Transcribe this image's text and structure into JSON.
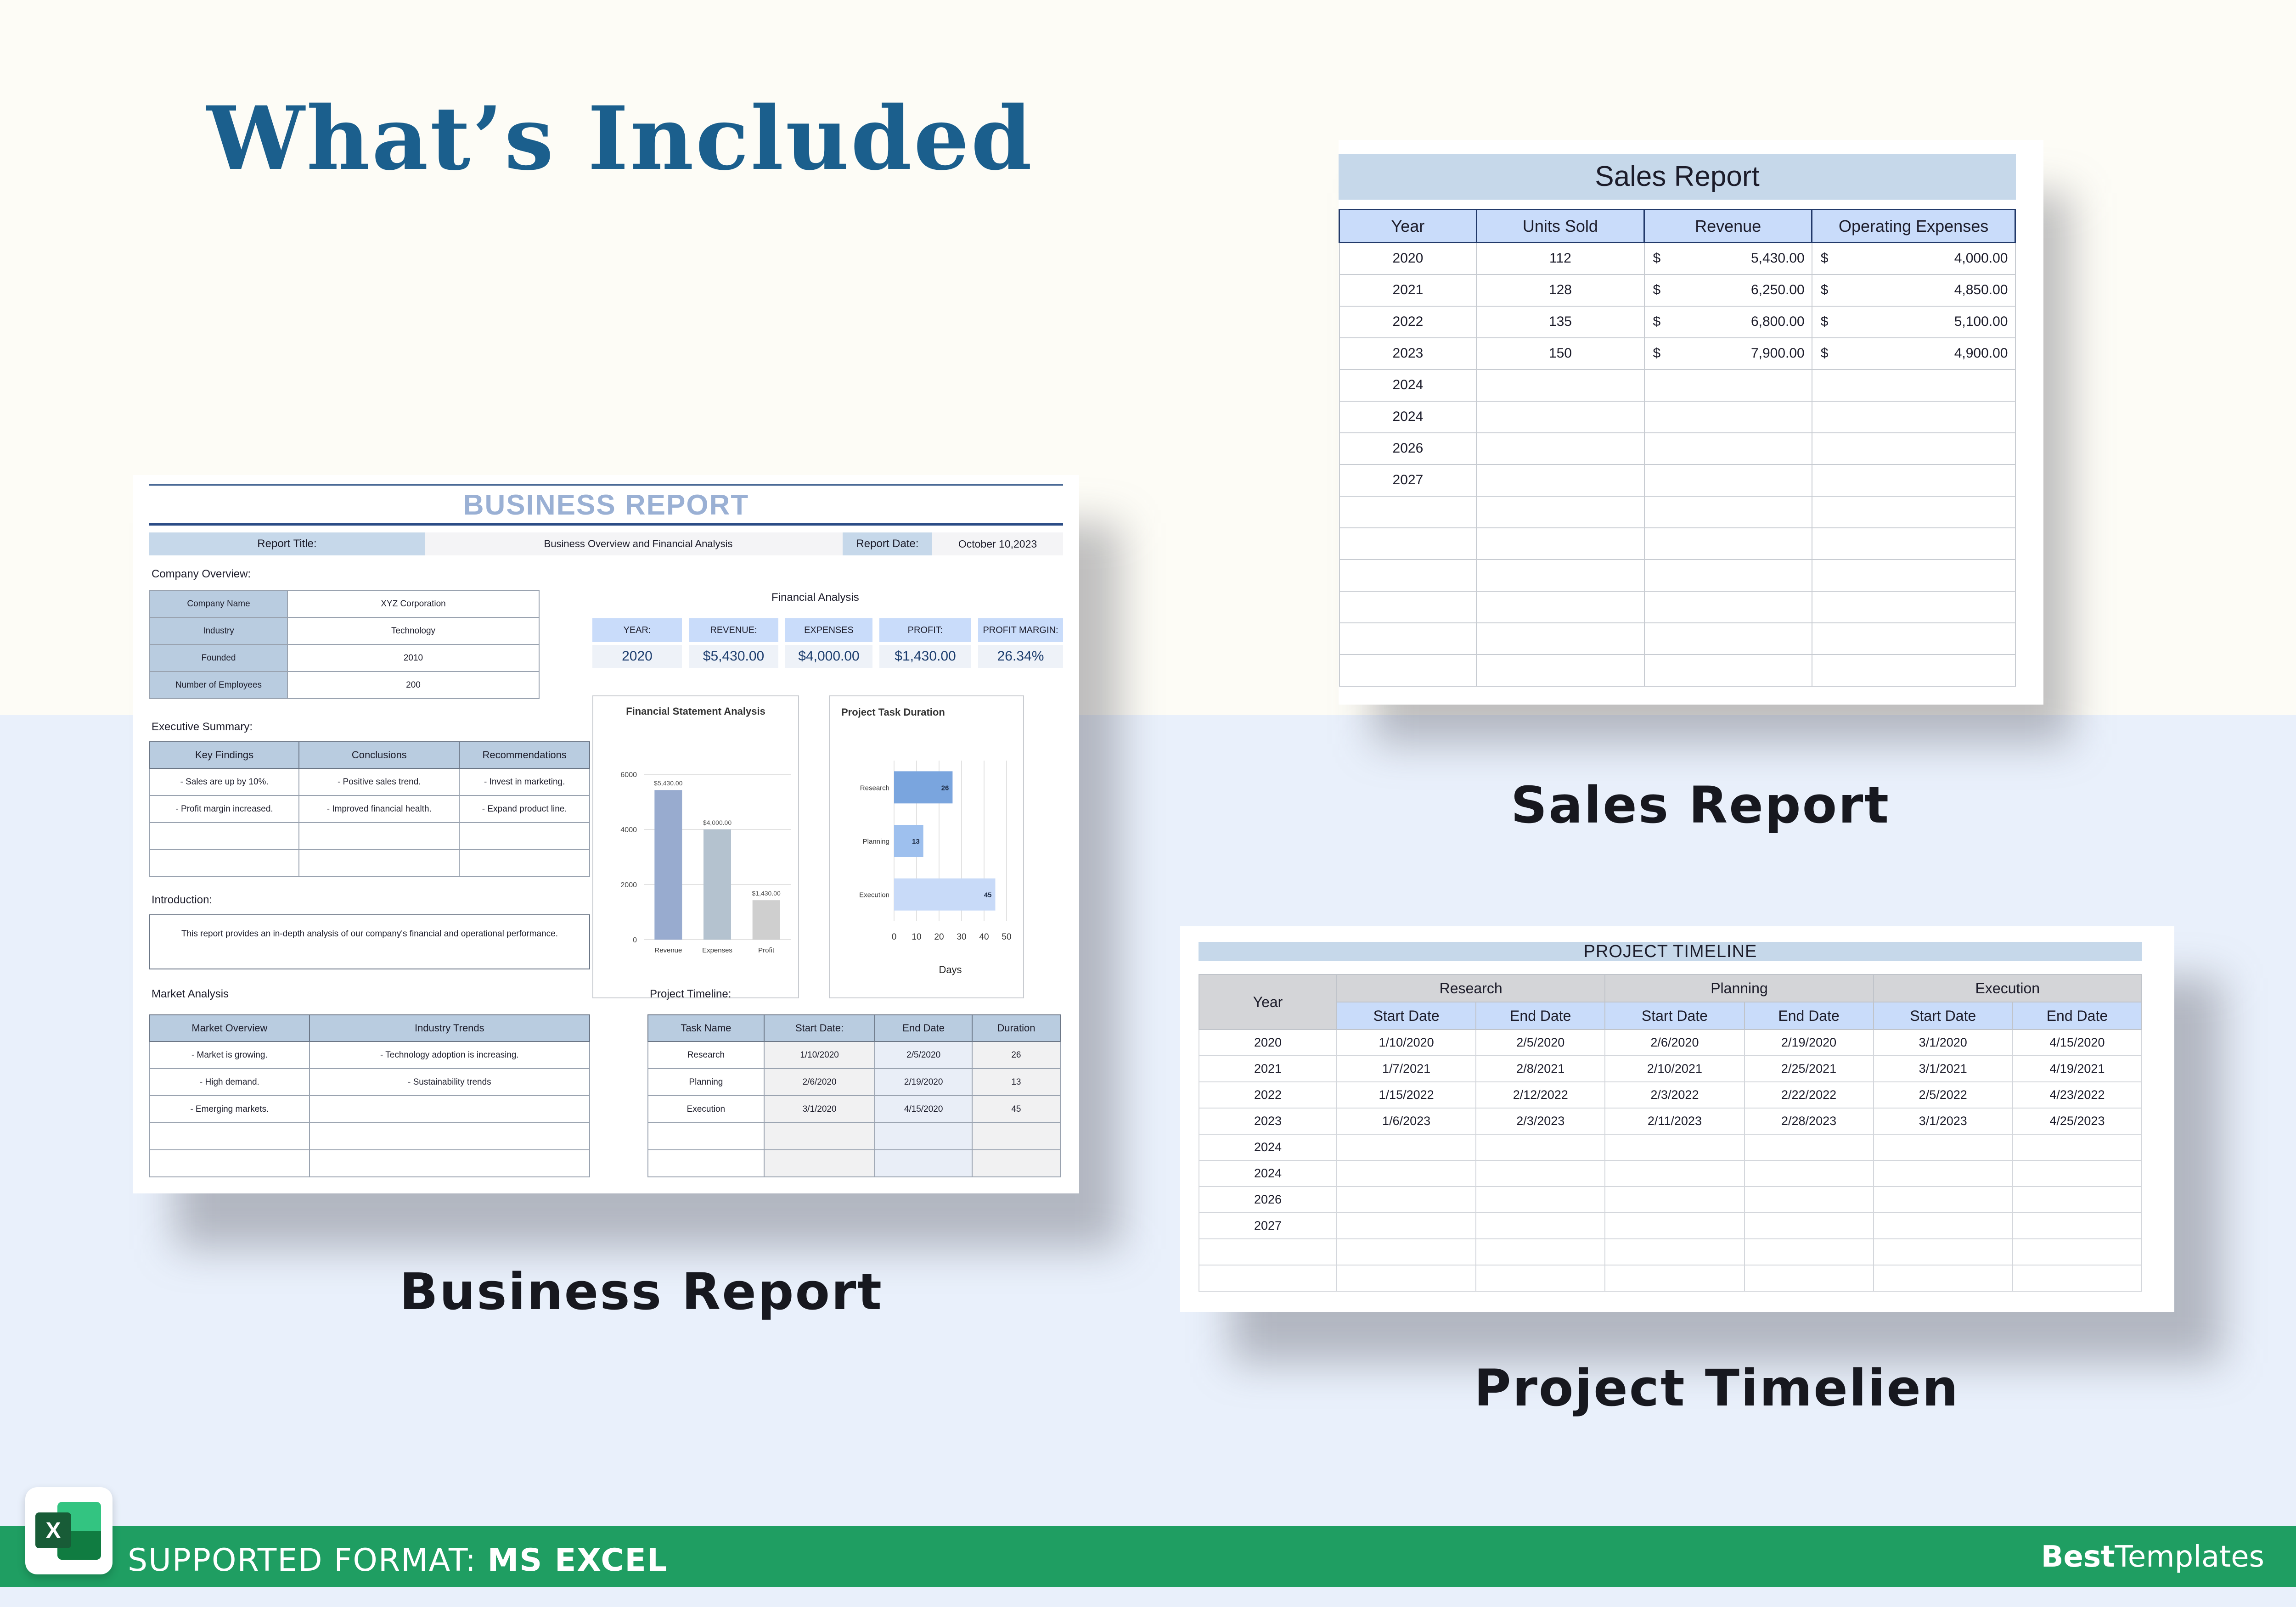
{
  "hero": {
    "title": "What’s Included"
  },
  "captions": {
    "sales": "Sales Report",
    "business": "Business Report",
    "timeline": "Project Timelien"
  },
  "footer": {
    "prefix": "SUPPORTED FORMAT: ",
    "format": "MS EXCEL",
    "brand_a": "Best",
    "brand_b": "Templates",
    "icon_letter": "X",
    "icon": "excel-icon"
  },
  "colors": {
    "accent": "#1b5f8d",
    "footer_green": "#1f9e62",
    "header_blue": "#c9dcfa",
    "title_blue": "#c6d8ea"
  },
  "sales_report": {
    "title": "Sales Report",
    "columns": [
      "Year",
      "Units Sold",
      "Revenue",
      "Operating Expenses"
    ],
    "currency": "$",
    "rows": [
      [
        "2020",
        "112",
        "5,430.00",
        "4,000.00"
      ],
      [
        "2021",
        "128",
        "6,250.00",
        "4,850.00"
      ],
      [
        "2022",
        "135",
        "6,800.00",
        "5,100.00"
      ],
      [
        "2023",
        "150",
        "7,900.00",
        "4,900.00"
      ],
      [
        "2024",
        "",
        "",
        ""
      ],
      [
        "2024",
        "",
        "",
        ""
      ],
      [
        "2026",
        "",
        "",
        ""
      ],
      [
        "2027",
        "",
        "",
        ""
      ],
      [
        "",
        "",
        "",
        ""
      ],
      [
        "",
        "",
        "",
        ""
      ],
      [
        "",
        "",
        "",
        ""
      ],
      [
        "",
        "",
        "",
        ""
      ],
      [
        "",
        "",
        "",
        ""
      ],
      [
        "",
        "",
        "",
        ""
      ]
    ]
  },
  "project_timeline": {
    "title": "PROJECT TIMELINE",
    "year_label": "Year",
    "groups": [
      "Research",
      "Planning",
      "Execution"
    ],
    "sub": [
      "Start Date",
      "End Date"
    ],
    "rows": [
      [
        "2020",
        "1/10/2020",
        "2/5/2020",
        "2/6/2020",
        "2/19/2020",
        "3/1/2020",
        "4/15/2020"
      ],
      [
        "2021",
        "1/7/2021",
        "2/8/2021",
        "2/10/2021",
        "2/25/2021",
        "3/1/2021",
        "4/19/2021"
      ],
      [
        "2022",
        "1/15/2022",
        "2/12/2022",
        "2/3/2022",
        "2/22/2022",
        "2/5/2022",
        "4/23/2022"
      ],
      [
        "2023",
        "1/6/2023",
        "2/3/2023",
        "2/11/2023",
        "2/28/2023",
        "3/1/2023",
        "4/25/2023"
      ],
      [
        "2024",
        "",
        "",
        "",
        "",
        "",
        ""
      ],
      [
        "2024",
        "",
        "",
        "",
        "",
        "",
        ""
      ],
      [
        "2026",
        "",
        "",
        "",
        "",
        "",
        ""
      ],
      [
        "2027",
        "",
        "",
        "",
        "",
        "",
        ""
      ],
      [
        "",
        "",
        "",
        "",
        "",
        "",
        ""
      ],
      [
        "",
        "",
        "",
        "",
        "",
        "",
        ""
      ]
    ]
  },
  "business_report": {
    "title": "BUSINESS REPORT",
    "report_title_label": "Report Title:",
    "report_title_value": "Business Overview and Financial Analysis",
    "report_date_label": "Report Date:",
    "report_date_value": "October 10,2023",
    "company_overview_label": "Company Overview:",
    "company": [
      [
        "Company Name",
        "XYZ Corporation"
      ],
      [
        "Industry",
        "Technology"
      ],
      [
        "Founded",
        "2010"
      ],
      [
        "Number of Employees",
        "200"
      ]
    ],
    "financial_label": "Financial Analysis",
    "kpis": [
      {
        "label": "YEAR:",
        "value": "2020"
      },
      {
        "label": "REVENUE:",
        "value": "$5,430.00"
      },
      {
        "label": "EXPENSES",
        "value": "$4,000.00"
      },
      {
        "label": "PROFIT:",
        "value": "$1,430.00"
      },
      {
        "label": "PROFIT MARGIN:",
        "value": "26.34%"
      }
    ],
    "exec_label": "Executive Summary:",
    "exec_columns": [
      "Key Findings",
      "Conclusions",
      "Recommendations"
    ],
    "exec_rows": [
      [
        "- Sales are up by 10%.",
        "- Positive sales trend.",
        "- Invest in marketing."
      ],
      [
        "- Profit margin increased.",
        "- Improved financial health.",
        "- Expand product line."
      ],
      [
        "",
        "",
        ""
      ],
      [
        "",
        "",
        ""
      ]
    ],
    "intro_label": "Introduction:",
    "intro_text": "This report provides an in-depth analysis of our company's financial and  operational performance.",
    "market_label": "Market Analysis",
    "market_columns": [
      "Market Overview",
      "Industry Trends"
    ],
    "market_rows": [
      [
        "- Market is growing.",
        "- Technology adoption is increasing."
      ],
      [
        "- High demand.",
        "- Sustainability trends"
      ],
      [
        "- Emerging markets.",
        ""
      ],
      [
        "",
        ""
      ],
      [
        "",
        ""
      ]
    ],
    "timeline_label": "Project Timeline:",
    "timeline_columns": [
      "Task Name",
      "Start Date:",
      "End Date",
      "Duration"
    ],
    "timeline_rows": [
      [
        "Research",
        "1/10/2020",
        "2/5/2020",
        "26"
      ],
      [
        "Planning",
        "2/6/2020",
        "2/19/2020",
        "13"
      ],
      [
        "Execution",
        "3/1/2020",
        "4/15/2020",
        "45"
      ],
      [
        "",
        "",
        "",
        ""
      ],
      [
        "",
        "",
        "",
        ""
      ]
    ]
  },
  "chart_data": [
    {
      "type": "bar",
      "title": "Financial Statement Analysis",
      "categories": [
        "Revenue",
        "Expenses",
        "Profit"
      ],
      "values": [
        5430,
        4000,
        1430
      ],
      "data_labels": [
        "$5,430.00",
        "$4,000.00",
        "$1,430.00"
      ],
      "yticks": [
        "0",
        "2000",
        "4000",
        "6000"
      ],
      "ylim": [
        0,
        6000
      ],
      "colors": [
        "#98abcf",
        "#b4c2cf",
        "#cfcfcf"
      ]
    },
    {
      "type": "bar",
      "orientation": "horizontal",
      "title": "Project Task Duration",
      "categories": [
        "Research",
        "Planning",
        "Execution"
      ],
      "values": [
        26,
        13,
        45
      ],
      "xticks": [
        "0",
        "10",
        "20",
        "30",
        "40",
        "50"
      ],
      "xlim": [
        0,
        50
      ],
      "xlabel": "Days",
      "colors": [
        "#7aa5de",
        "#9ec0ee",
        "#c8daf8"
      ]
    }
  ]
}
